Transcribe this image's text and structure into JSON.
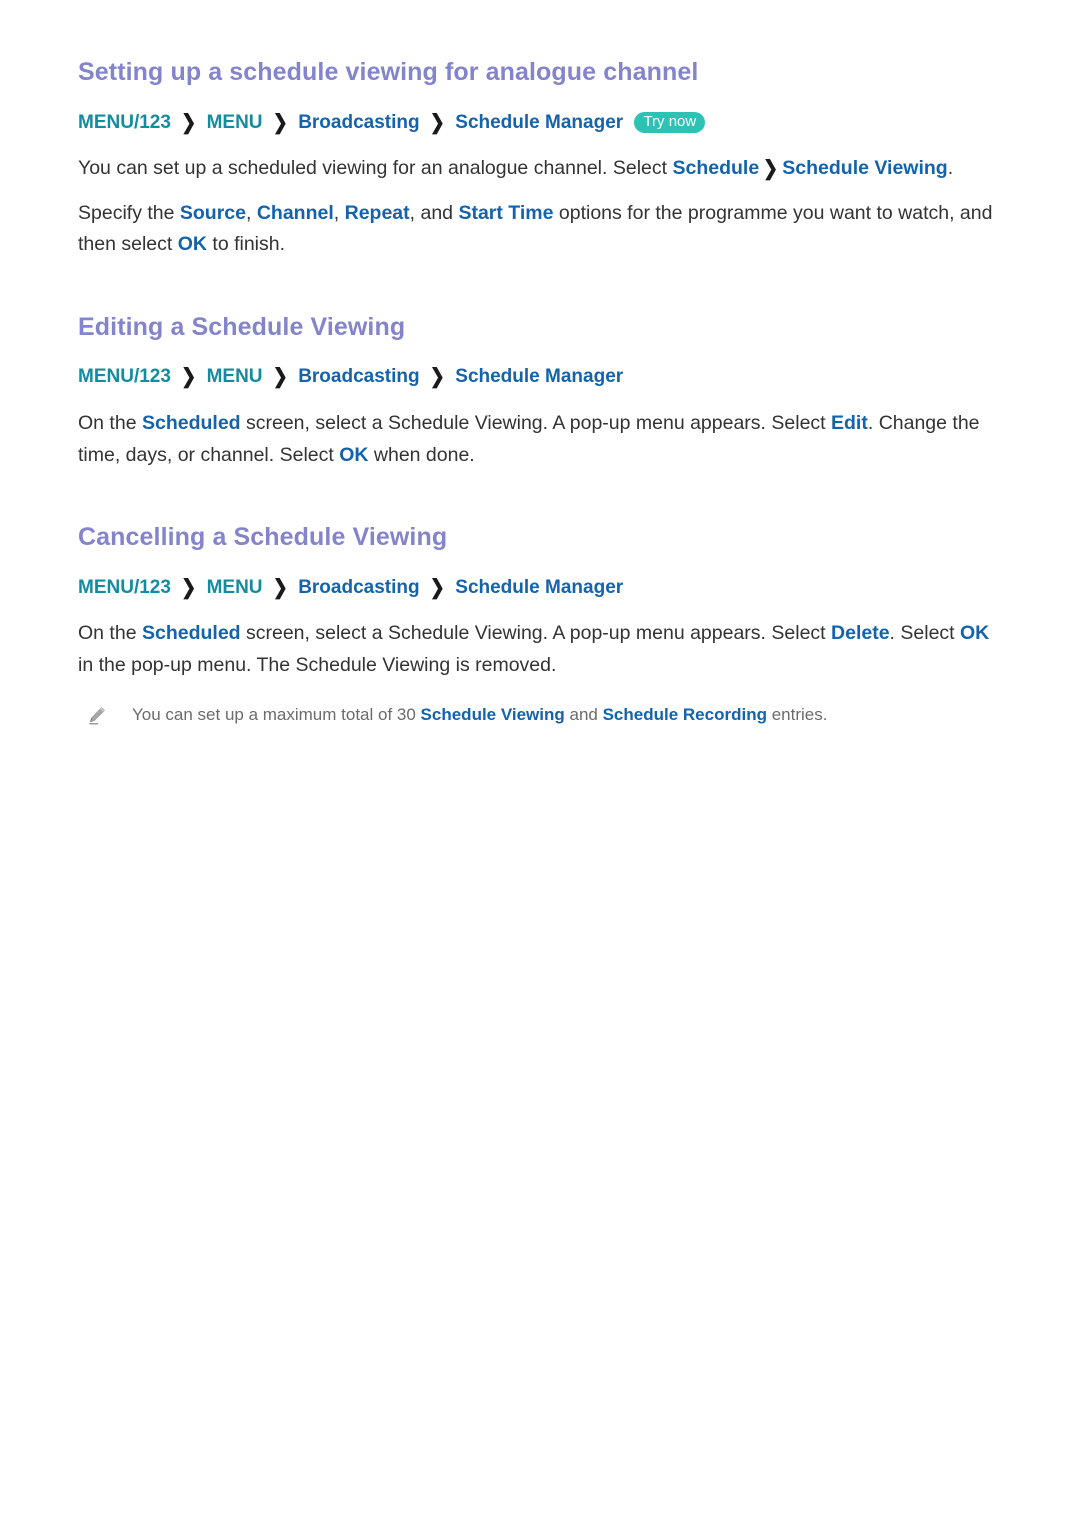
{
  "document": {
    "background": "#ffffff",
    "accent_heading": "#8484cc",
    "accent_link": "#1463ad",
    "accent_menu": "#138ca0",
    "badge_color": "#2cc3b4",
    "note_color": "#6b6b6b"
  },
  "sections": [
    {
      "id": "setting-up-schedule-viewing-analogue",
      "title": "Setting up a schedule viewing for analogue channel",
      "breadcrumb": {
        "items": [
          "MENU/123",
          "MENU",
          "Broadcasting",
          "Schedule Manager"
        ],
        "separator": "❯",
        "badge": "Try now"
      },
      "paragraphs": {
        "p1": {
          "t1": "You can set up a scheduled viewing for an analogue channel. Select ",
          "k1": "Schedule",
          "sep": "❯",
          "k2": "Schedule Viewing",
          "t2": "."
        },
        "p2": {
          "t1": "Specify the ",
          "k1": "Source",
          "t2": ", ",
          "k2": "Channel",
          "t3": ", ",
          "k3": "Repeat",
          "t4": ", and ",
          "k4": "Start Time",
          "t5": " options for the programme you want to watch, and then select ",
          "k5": "OK",
          "t6": " to finish."
        }
      }
    },
    {
      "id": "editing-a-schedule-viewing",
      "title": "Editing a Schedule Viewing",
      "breadcrumb": {
        "items": [
          "MENU/123",
          "MENU",
          "Broadcasting",
          "Schedule Manager"
        ],
        "separator": "❯",
        "badge": ""
      },
      "paragraphs": {
        "p1": {
          "t1": "On the ",
          "k1": "Scheduled",
          "t2": " screen, select a Schedule Viewing. A pop-up menu appears. Select ",
          "k2": "Edit",
          "t3": ". Change the time, days, or channel. Select ",
          "k3": "OK",
          "t4": " when done."
        }
      }
    },
    {
      "id": "cancelling-a-schedule-viewing",
      "title": "Cancelling a Schedule Viewing",
      "breadcrumb": {
        "items": [
          "MENU/123",
          "MENU",
          "Broadcasting",
          "Schedule Manager"
        ],
        "separator": "❯",
        "badge": ""
      },
      "paragraphs": {
        "p1": {
          "t1": "On the ",
          "k1": "Scheduled",
          "t2": " screen, select a Schedule Viewing. A pop-up menu appears. Select ",
          "k2": "Delete",
          "t3": ". Select ",
          "k3": "OK",
          "t4": " in the pop-up menu. The Schedule Viewing is removed."
        }
      },
      "note": {
        "icon": "pencil-icon",
        "t1": "You can set up a maximum total of 30 ",
        "k1": "Schedule Viewing",
        "t2": " and ",
        "k2": "Schedule Recording",
        "t3": " entries."
      }
    }
  ]
}
